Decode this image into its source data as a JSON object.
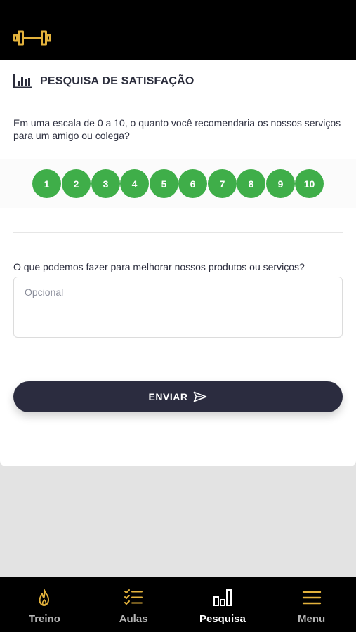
{
  "colors": {
    "accent_gold": "#e3b23c",
    "scale_green": "#3fae49",
    "primary_dark": "#2b2c3f",
    "topbar_bg": "#000000"
  },
  "header": {
    "logo_icon": "dumbbell-icon"
  },
  "survey": {
    "title_icon": "bar-chart-icon",
    "title": "PESQUISA DE SATISFAÇÃO",
    "question_nps": "Em uma escala de 0 a 10, o quanto você recomendaria os nossos serviços para um amigo ou colega?",
    "scale": [
      "1",
      "2",
      "3",
      "4",
      "5",
      "6",
      "7",
      "8",
      "9",
      "10"
    ],
    "question_improve": "O que podemos fazer para melhorar nossos produtos ou serviços?",
    "feedback_placeholder": "Opcional",
    "send_label": "ENVIAR",
    "send_icon": "paper-plane-icon"
  },
  "nav": {
    "items": [
      {
        "label": "Treino",
        "icon": "flame-icon",
        "active": false
      },
      {
        "label": "Aulas",
        "icon": "checklist-icon",
        "active": false
      },
      {
        "label": "Pesquisa",
        "icon": "bar-chart-icon",
        "active": true
      },
      {
        "label": "Menu",
        "icon": "hamburger-icon",
        "active": false
      }
    ]
  }
}
